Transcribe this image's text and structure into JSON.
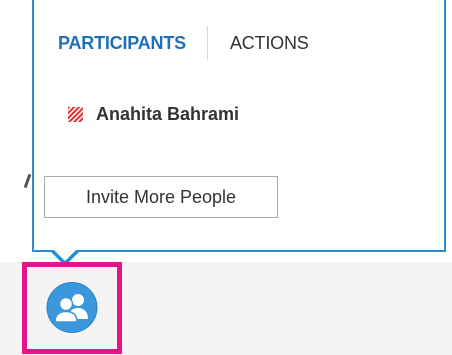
{
  "tabs": {
    "participants": "PARTICIPANTS",
    "actions": "ACTIONS"
  },
  "participants": [
    {
      "name": "Anahita Bahrami",
      "status_icon": "striped-presence-icon",
      "status_color": "#e03a3a"
    }
  ],
  "invite_button_label": "Invite More People",
  "participants_toggle_icon": "people-icon",
  "colors": {
    "accent": "#1f6fb8",
    "popup_border": "#2a8dd4",
    "icon_fill": "#3a97dc",
    "highlight": "#e4148c",
    "text": "#333333"
  }
}
